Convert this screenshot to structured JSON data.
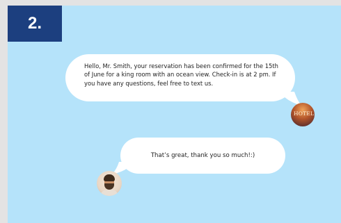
{
  "step": {
    "label": "2."
  },
  "chat": {
    "hotel_message": "Hello, Mr. Smith, your reservation has been confirmed for the 15th of June for a king room with an ocean view. Check-in is at 2 pm. If you have any questions, feel free to text us.",
    "hotel_avatar": {
      "sign_text": "HOTEL"
    },
    "guest_message": "That’s great, thank you so much!:)"
  },
  "colors": {
    "background": "#b5e3fa",
    "badge": "#1c3f7f",
    "bubble": "#ffffff"
  },
  "icons": [
    "hotel-avatar",
    "guest-avatar"
  ]
}
